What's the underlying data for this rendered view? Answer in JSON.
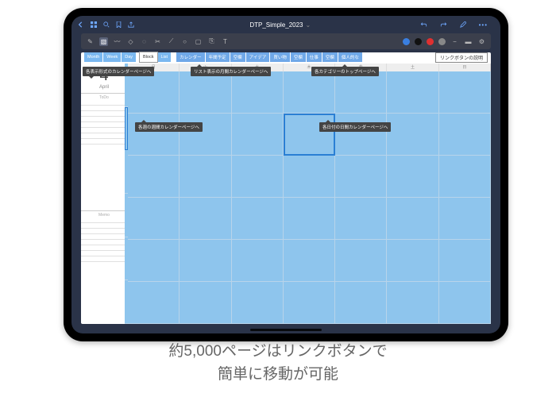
{
  "app": {
    "document_title": "DTP_Simple_2023",
    "toolbar_colors": [
      "#3a7fe0",
      "#111",
      "#e03030",
      "#888"
    ]
  },
  "nav": {
    "view_buttons": [
      "Month",
      "Week",
      "Day"
    ],
    "block_label": "Block",
    "list_label": "List",
    "category_buttons": [
      "カレンダー",
      "年間予定",
      "空欄",
      "アイデア",
      "買い物",
      "空欄",
      "仕事",
      "空欄",
      "個人的な"
    ],
    "explain_label": "リンクボタンの説明"
  },
  "sidebar": {
    "day_number": "4",
    "month_name": "April",
    "sections": [
      "ToDo",
      "Memo"
    ]
  },
  "calendar": {
    "day_headers": [
      "月",
      "火",
      "水",
      "木",
      "金",
      "土",
      "日"
    ],
    "rows": 6,
    "cols": 7
  },
  "callouts": {
    "view_format": "各表示形式のカレンダーページへ",
    "monthly_list": "リスト表示の月間カレンダーページへ",
    "category_top": "各カテゴリーのトップページへ",
    "weekly": "各週の週間カレンダーページへ",
    "daily": "各日付の日間カレンダーページへ"
  },
  "caption": {
    "line1": "約5,000ページはリンクボタンで",
    "line2": "簡単に移動が可能"
  }
}
